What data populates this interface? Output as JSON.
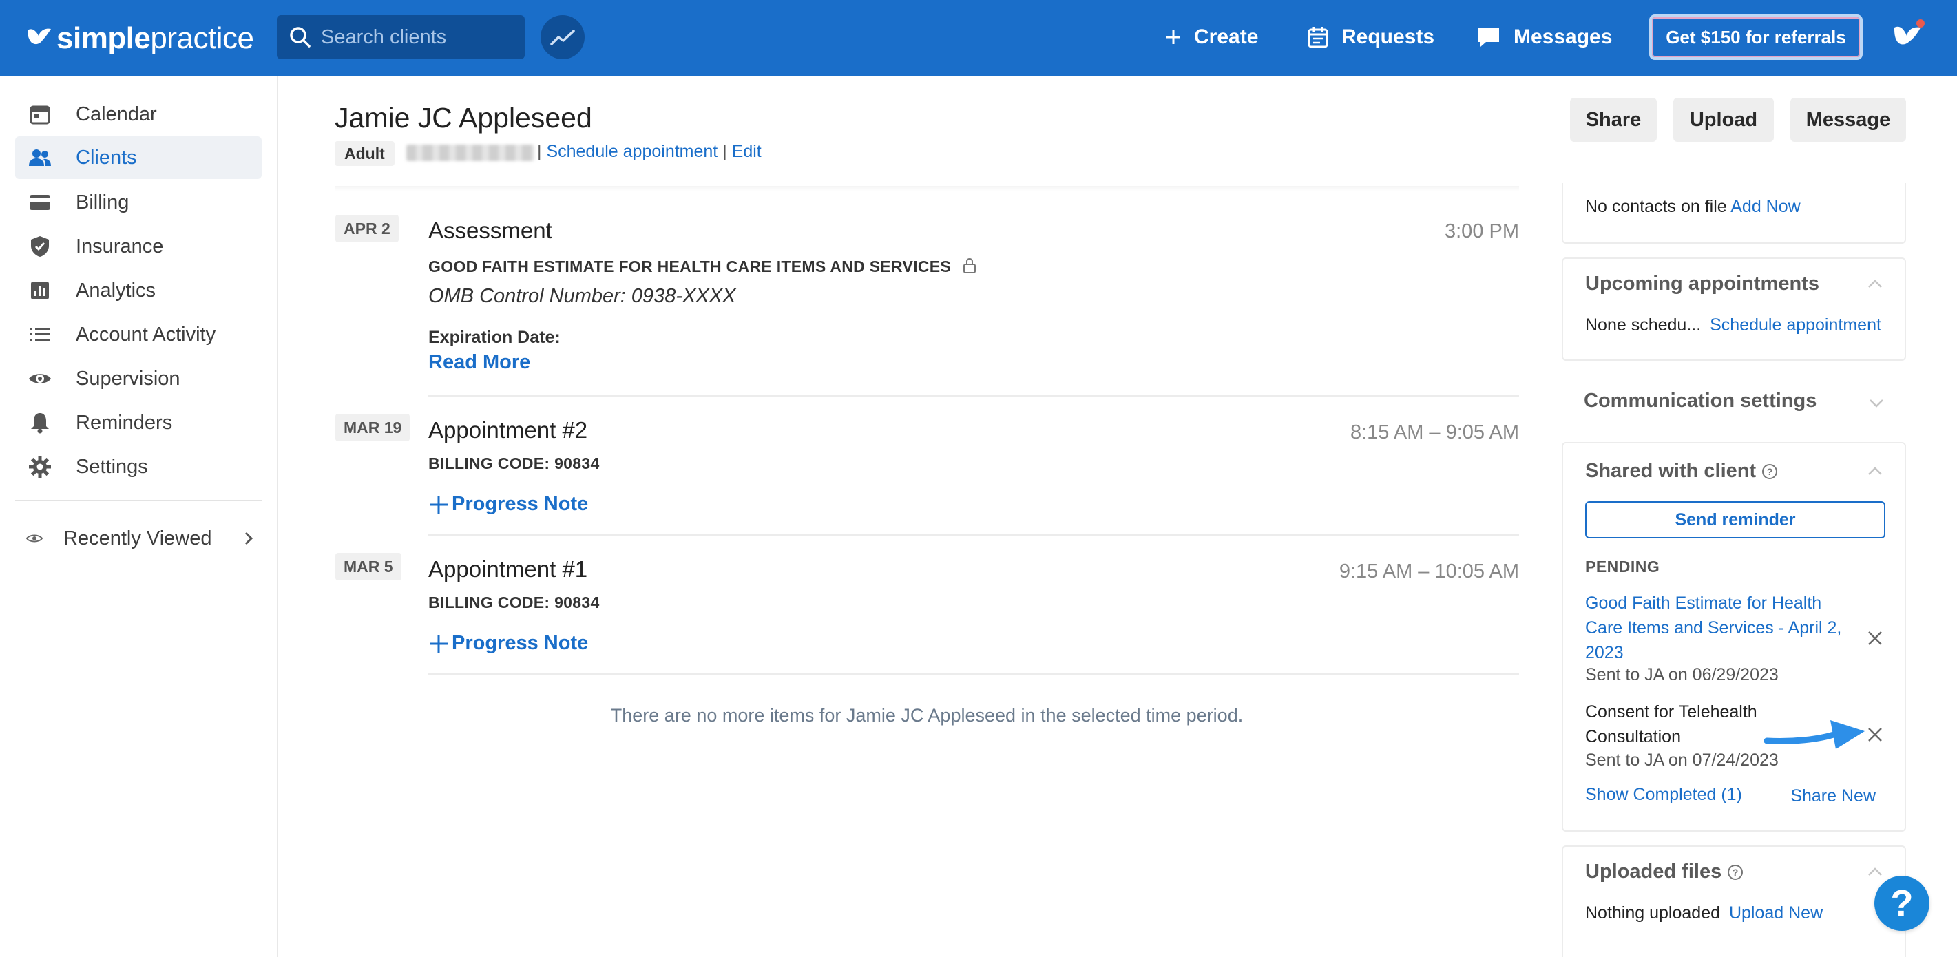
{
  "topbar": {
    "logo_bold": "simple",
    "logo_light": "practice",
    "search_placeholder": "Search clients",
    "create_label": "Create",
    "requests_label": "Requests",
    "messages_label": "Messages",
    "referral_label": "Get $150 for referrals"
  },
  "sidebar": {
    "items": [
      {
        "label": "Calendar",
        "icon": "calendar-icon"
      },
      {
        "label": "Clients",
        "icon": "clients-icon",
        "active": true
      },
      {
        "label": "Billing",
        "icon": "billing-icon"
      },
      {
        "label": "Insurance",
        "icon": "shield-icon"
      },
      {
        "label": "Analytics",
        "icon": "analytics-icon"
      },
      {
        "label": "Account Activity",
        "icon": "list-icon"
      },
      {
        "label": "Supervision",
        "icon": "eye-icon"
      },
      {
        "label": "Reminders",
        "icon": "bell-icon"
      },
      {
        "label": "Settings",
        "icon": "gear-icon"
      }
    ],
    "recently_viewed": "Recently Viewed"
  },
  "client": {
    "name": "Jamie JC Appleseed",
    "tag": "Adult",
    "sep1": "|",
    "schedule_link": "Schedule appointment",
    "sep2": "|",
    "edit_link": "Edit"
  },
  "header_buttons": {
    "share": "Share",
    "upload": "Upload",
    "message": "Message"
  },
  "timeline": {
    "items": [
      {
        "date": "APR 2",
        "title": "Assessment",
        "time": "3:00 PM",
        "subtitle": "GOOD FAITH ESTIMATE FOR HEALTH CARE ITEMS AND SERVICES",
        "italic": "OMB Control Number: 0938-XXXX",
        "label": "Expiration Date:",
        "link": "Read More"
      },
      {
        "date": "MAR 19",
        "title": "Appointment #2",
        "time": "8:15 AM – 9:05 AM",
        "subtitle": "BILLING CODE: 90834",
        "link": "Progress Note"
      },
      {
        "date": "MAR 5",
        "title": "Appointment #1",
        "time": "9:15 AM – 10:05 AM",
        "subtitle": "BILLING CODE: 90834",
        "link": "Progress Note"
      }
    ],
    "no_more": "There are no more items for Jamie JC Appleseed in the selected time period."
  },
  "right_panel": {
    "contacts_text": "No contacts on file",
    "contacts_link": "Add Now",
    "upcoming_title": "Upcoming appointments",
    "upcoming_text": "None schedu...",
    "upcoming_link": "Schedule appointment",
    "comm_title": "Communication settings",
    "shared_title": "Shared with client",
    "send_reminder": "Send reminder",
    "pending_label": "PENDING",
    "pending_items": [
      {
        "title_lines": [
          "Good Faith Estimate for Health",
          "Care Items and Services - April 2,",
          "2023"
        ],
        "sent": "Sent to JA on 06/29/2023",
        "is_link": true
      },
      {
        "title_lines": [
          "Consent for Telehealth",
          "Consultation"
        ],
        "sent": "Sent to JA on 07/24/2023",
        "is_link": false
      }
    ],
    "show_completed": "Show Completed (1)",
    "share_new": "Share New",
    "uploaded_title": "Uploaded files",
    "uploaded_text": "Nothing uploaded",
    "uploaded_link": "Upload New"
  },
  "help_label": "?",
  "colors": {
    "brand": "#1a6ec9",
    "brand_dark": "#0f4f97",
    "accent_arrow": "#2d8fe8"
  }
}
